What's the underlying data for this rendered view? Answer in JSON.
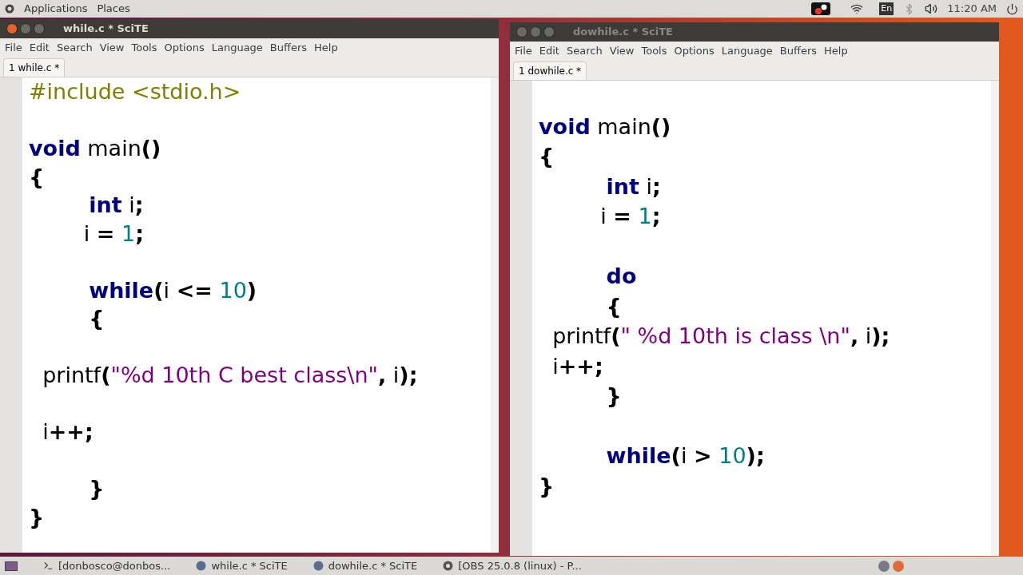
{
  "top_panel": {
    "menus": [
      "Applications",
      "Places"
    ],
    "keyboard": "En",
    "clock": "11:20 AM"
  },
  "windows": [
    {
      "title": "while.c * SciTE",
      "active": true,
      "menu": [
        "File",
        "Edit",
        "Search",
        "View",
        "Tools",
        "Options",
        "Language",
        "Buffers",
        "Help"
      ],
      "tab": "1 while.c *",
      "lines": [
        {
          "kind": "code",
          "tokens": [
            {
              "kind": "preprocessor",
              "text": "#include <stdio.h>"
            }
          ]
        },
        {
          "kind": "blank"
        },
        {
          "kind": "code",
          "tokens": [
            {
              "kind": "keyword",
              "text": "void"
            },
            {
              "kind": "identifier",
              "text": " main"
            },
            {
              "kind": "operator",
              "text": "()"
            }
          ]
        },
        {
          "kind": "code",
          "tokens": [
            {
              "kind": "operator",
              "text": "{"
            }
          ]
        },
        {
          "kind": "code",
          "tokens": [
            {
              "kind": "keyword",
              "text": "        int"
            },
            {
              "kind": "identifier",
              "text": " i"
            },
            {
              "kind": "operator",
              "text": ";"
            }
          ]
        },
        {
          "kind": "code",
          "tokens": [
            {
              "kind": "identifier",
              "text": "        i "
            },
            {
              "kind": "operator",
              "text": "="
            },
            {
              "kind": "number",
              "text": " 1"
            },
            {
              "kind": "operator",
              "text": ";"
            }
          ]
        },
        {
          "kind": "blank"
        },
        {
          "kind": "code",
          "tokens": [
            {
              "kind": "keyword",
              "text": "        while"
            },
            {
              "kind": "operator",
              "text": "("
            },
            {
              "kind": "identifier",
              "text": "i "
            },
            {
              "kind": "operator",
              "text": "<="
            },
            {
              "kind": "number",
              "text": " 10"
            },
            {
              "kind": "operator",
              "text": ")"
            }
          ]
        },
        {
          "kind": "code",
          "tokens": [
            {
              "kind": "operator",
              "text": "        {"
            }
          ]
        },
        {
          "kind": "blank"
        },
        {
          "kind": "code",
          "tokens": [
            {
              "kind": "identifier",
              "text": "  printf"
            },
            {
              "kind": "operator",
              "text": "("
            },
            {
              "kind": "string",
              "text": "\"%d 10th C best class\\n\""
            },
            {
              "kind": "operator",
              "text": ","
            },
            {
              "kind": "identifier",
              "text": " i"
            },
            {
              "kind": "operator",
              "text": ");"
            }
          ]
        },
        {
          "kind": "blank"
        },
        {
          "kind": "code",
          "tokens": [
            {
              "kind": "identifier",
              "text": "  i"
            },
            {
              "kind": "operator",
              "text": "++;"
            }
          ]
        },
        {
          "kind": "blank"
        },
        {
          "kind": "code",
          "tokens": [
            {
              "kind": "operator",
              "text": "        }"
            }
          ]
        },
        {
          "kind": "code",
          "tokens": [
            {
              "kind": "operator",
              "text": "}"
            }
          ]
        }
      ]
    },
    {
      "title": "dowhile.c * SciTE",
      "active": false,
      "menu": [
        "File",
        "Edit",
        "Search",
        "View",
        "Tools",
        "Options",
        "Language",
        "Buffers",
        "Help"
      ],
      "tab": "1 dowhile.c *",
      "lines": [
        {
          "kind": "blank"
        },
        {
          "kind": "code",
          "tokens": [
            {
              "kind": "keyword",
              "text": "void"
            },
            {
              "kind": "identifier",
              "text": " main"
            },
            {
              "kind": "operator",
              "text": "()"
            }
          ]
        },
        {
          "kind": "code",
          "tokens": [
            {
              "kind": "operator",
              "text": "{"
            }
          ]
        },
        {
          "kind": "code",
          "tokens": [
            {
              "kind": "keyword",
              "text": "         int"
            },
            {
              "kind": "identifier",
              "text": " i"
            },
            {
              "kind": "operator",
              "text": ";"
            }
          ]
        },
        {
          "kind": "code",
          "tokens": [
            {
              "kind": "identifier",
              "text": "         i "
            },
            {
              "kind": "operator",
              "text": "="
            },
            {
              "kind": "number",
              "text": " 1"
            },
            {
              "kind": "operator",
              "text": ";"
            }
          ]
        },
        {
          "kind": "blank"
        },
        {
          "kind": "code",
          "tokens": [
            {
              "kind": "keyword",
              "text": "         do"
            }
          ]
        },
        {
          "kind": "code",
          "tokens": [
            {
              "kind": "operator",
              "text": "         {"
            }
          ]
        },
        {
          "kind": "code",
          "tokens": [
            {
              "kind": "identifier",
              "text": "  printf"
            },
            {
              "kind": "operator",
              "text": "("
            },
            {
              "kind": "string",
              "text": "\" %d 10th is class \\n\""
            },
            {
              "kind": "operator",
              "text": ","
            },
            {
              "kind": "identifier",
              "text": " i"
            },
            {
              "kind": "operator",
              "text": ");"
            }
          ]
        },
        {
          "kind": "code",
          "tokens": [
            {
              "kind": "identifier",
              "text": "  i"
            },
            {
              "kind": "operator",
              "text": "++;"
            }
          ]
        },
        {
          "kind": "code",
          "tokens": [
            {
              "kind": "operator",
              "text": "         }"
            }
          ]
        },
        {
          "kind": "blank"
        },
        {
          "kind": "code",
          "tokens": [
            {
              "kind": "keyword",
              "text": "         while"
            },
            {
              "kind": "operator",
              "text": "("
            },
            {
              "kind": "identifier",
              "text": "i "
            },
            {
              "kind": "operator",
              "text": ">"
            },
            {
              "kind": "number",
              "text": " 10"
            },
            {
              "kind": "operator",
              "text": ");"
            }
          ]
        },
        {
          "kind": "code",
          "tokens": [
            {
              "kind": "operator",
              "text": "}"
            }
          ]
        }
      ]
    }
  ],
  "taskbar": [
    {
      "kind": "terminal",
      "label": "[donbosco@donbos..."
    },
    {
      "kind": "editor",
      "label": "while.c * SciTE"
    },
    {
      "kind": "editor",
      "label": "dowhile.c * SciTE"
    },
    {
      "kind": "obs",
      "label": "[OBS 25.0.8 (linux) - P..."
    }
  ]
}
